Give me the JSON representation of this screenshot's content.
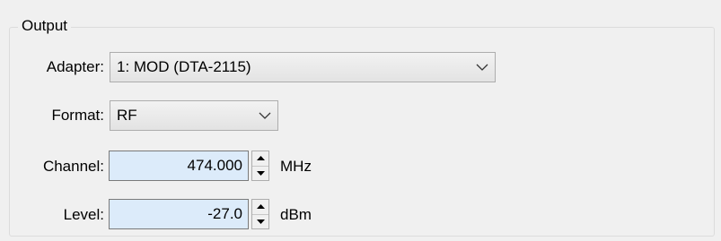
{
  "output_group": {
    "title": "Output",
    "adapter": {
      "label": "Adapter:",
      "value": "1: MOD (DTA-2115)",
      "arrow_icon": "chevron-down-icon"
    },
    "format": {
      "label": "Format:",
      "value": "RF",
      "arrow_icon": "chevron-down-icon"
    },
    "channel": {
      "label": "Channel:",
      "value": "474.000",
      "unit": "MHz"
    },
    "level": {
      "label": "Level:",
      "value": "-27.0",
      "unit": "dBm"
    }
  },
  "colors": {
    "background": "#f0f0f0",
    "field_background": "#dcebfa",
    "group_border": "#dcdcdc"
  }
}
